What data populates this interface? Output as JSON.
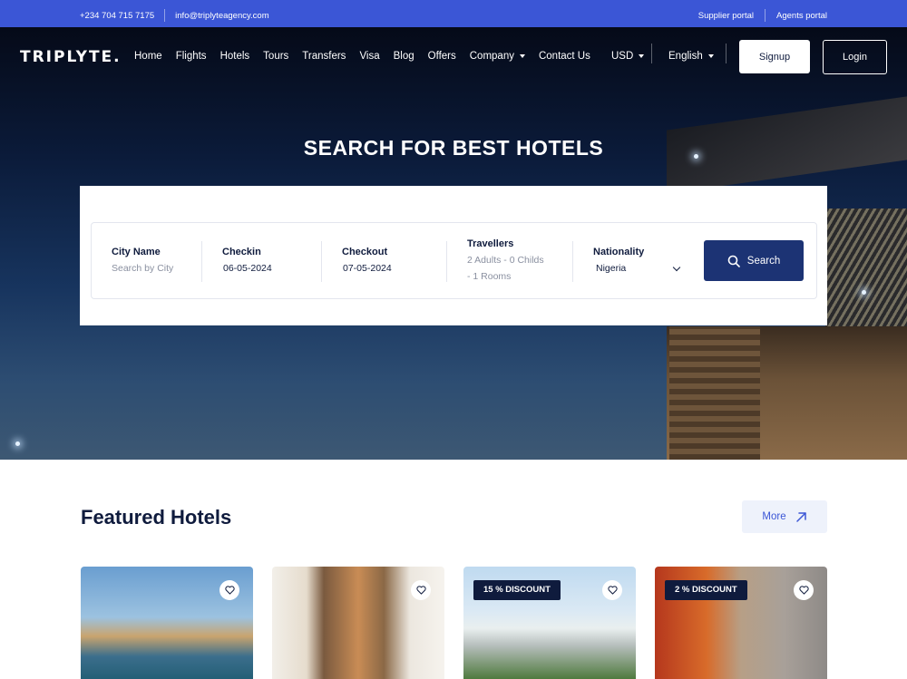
{
  "topbar": {
    "phone": "+234 704 715 7175",
    "email": "info@triplyteagency.com",
    "supplier_portal": "Supplier portal",
    "agents_portal": "Agents portal"
  },
  "brand": {
    "logo_text": "TRIPLYTE."
  },
  "nav": {
    "items": [
      "Home",
      "Flights",
      "Hotels",
      "Tours",
      "Transfers",
      "Visa",
      "Blog",
      "Offers"
    ],
    "company": "Company",
    "contact": "Contact Us",
    "currency": "USD",
    "language": "English",
    "signup": "Signup",
    "login": "Login"
  },
  "hero": {
    "title": "SEARCH FOR BEST HOTELS"
  },
  "search": {
    "city_label": "City Name",
    "city_placeholder": "Search by City",
    "checkin_label": "Checkin",
    "checkin_value": "06-05-2024",
    "checkout_label": "Checkout",
    "checkout_value": "07-05-2024",
    "travellers_label": "Travellers",
    "travellers_line1": "2 Adults - 0 Childs",
    "travellers_line2": "- 1 Rooms",
    "nationality_label": "Nationality",
    "nationality_value": "Nigeria",
    "search_button": "Search"
  },
  "featured": {
    "title": "Featured Hotels",
    "more_button": "More",
    "cards": [
      {
        "badge": ""
      },
      {
        "badge": ""
      },
      {
        "badge": "15 % DISCOUNT"
      },
      {
        "badge": "2 % DISCOUNT"
      }
    ]
  },
  "colors": {
    "topbar": "#3b56d6",
    "primary_dark": "#1c3374",
    "text_dark": "#0f1b3d",
    "more_bg": "#eef2fb"
  }
}
